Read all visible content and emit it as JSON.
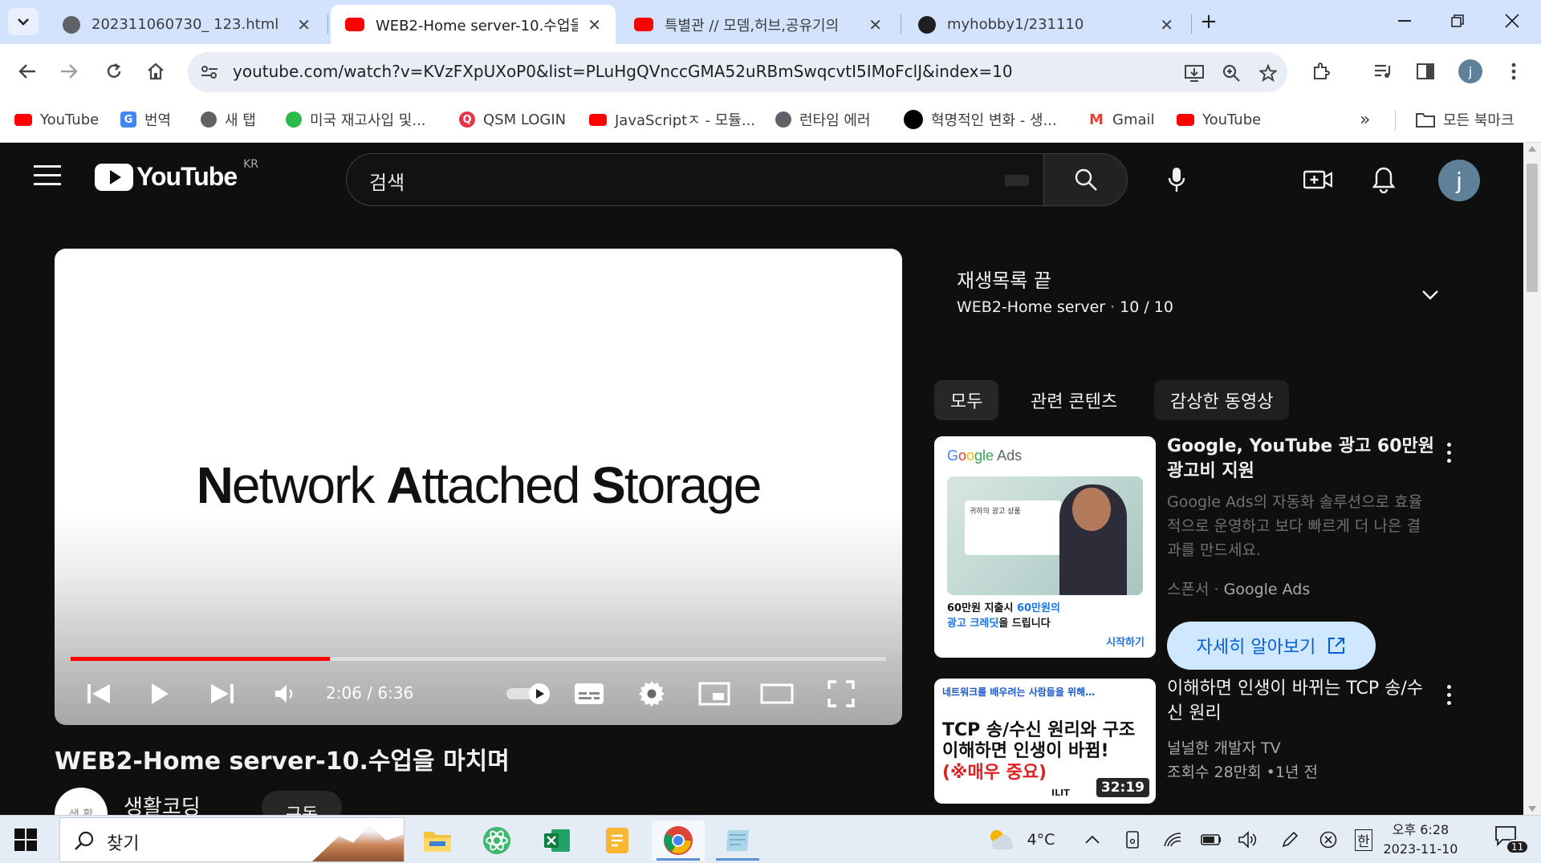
{
  "browser": {
    "tabs": [
      {
        "title": "202311060730_ 123.html",
        "icon": "globe-icon"
      },
      {
        "title": "WEB2-Home server-10.수업을",
        "icon": "youtube-icon",
        "active": true
      },
      {
        "title": "특별관 // 모뎀,허브,공유기의 ",
        "icon": "youtube-icon"
      },
      {
        "title": "myhobby1/231110",
        "icon": "github-icon"
      }
    ],
    "url": "youtube.com/watch?v=KVzFXpUXoP0&list=PLuHgQVnccGMA52uRBmSwqcvtI5IMoFclJ&index=10",
    "profile_initial": "j",
    "bookmarks": [
      {
        "label": "YouTube",
        "icon": "youtube-icon"
      },
      {
        "label": "번역",
        "icon": "translate-icon"
      },
      {
        "label": "새 탭",
        "icon": "globe-icon"
      },
      {
        "label": "미국 재고사입 및...",
        "icon": "frog-icon"
      },
      {
        "label": "QSM LOGIN",
        "icon": "q-icon"
      },
      {
        "label": "JavaScriptㅈ - 모듈...",
        "icon": "youtube-icon"
      },
      {
        "label": "런타임 에러",
        "icon": "globe-icon"
      },
      {
        "label": "혁명적인 변화 - 생...",
        "icon": "black-circle-icon"
      },
      {
        "label": "Gmail",
        "icon": "gmail-icon"
      },
      {
        "label": "YouTube",
        "icon": "youtube-icon"
      }
    ],
    "bookmarks_more": "»",
    "all_bookmarks": "모든 북마크"
  },
  "youtube": {
    "logo_text": "YouTube",
    "region": "KR",
    "search_placeholder": "검색",
    "avatar_initial": "j",
    "player": {
      "slide_text": {
        "n": "N",
        "etwork": "etwork ",
        "a": "A",
        "ttached": "ttached ",
        "s": "S",
        "torage": "torage"
      },
      "time": "2:06 / 6:36",
      "progress_fraction": 0.318
    },
    "video_title": "WEB2-Home server-10.수업을 마치며",
    "channel_avatar_text": "생 활",
    "channel_name": "생활코딩",
    "subscribe_label": "구독",
    "playlist": {
      "title": "재생목록 끝",
      "name": "WEB2-Home server",
      "separator": "·",
      "position": "10 / 10"
    },
    "chips": [
      "모두",
      "관련 콘텐츠",
      "감상한 동영상"
    ],
    "ad": {
      "brand": {
        "g1": "G",
        "g2": "o",
        "g3": "o",
        "g4": "gle",
        "ads": " Ads"
      },
      "card_text": "귀하의 광고 상품",
      "caption_line1_a": "60만원 지출시 ",
      "caption_line1_b": "60만원의",
      "caption_line2_a": "광고 크레딧",
      "caption_line2_b": "을 드립니다",
      "cta_small": "시작하기",
      "title": "Google, YouTube 광고 60만원 광고비 지원",
      "description": "Google Ads의 자동화 솔루션으로 효율적으로 운영하고 보다 빠르게 더 나은 결과를 만드세요.",
      "sponsor_label": "스폰서",
      "sponsor_dot": "·",
      "sponsor_name": "Google Ads",
      "learn_more": "자세히 알아보기"
    },
    "rec": {
      "thumb_top": "네트워크를 배우려는 사람들을 위해…",
      "thumb_line1": "TCP 송/수신 원리와 구조",
      "thumb_line2": "이해하면 인생이 바뀜!",
      "thumb_line3": "(※매우 중요)",
      "thumb_logo": "ILIT",
      "duration": "32:19",
      "title": "이해하면 인생이 바뀌는 TCP 송/수신 원리",
      "channel": "널널한 개발자 TV",
      "views": "조회수 28만회",
      "age": "•1년 전"
    }
  },
  "taskbar": {
    "search_label": "찾기",
    "weather": "4°C",
    "ime": "한",
    "time": "오후 6:28",
    "date": "2023-11-10",
    "notification_count": "11"
  },
  "colors": {
    "yt_bg": "#0f0f0f",
    "accent_red": "#ff0000",
    "chrome_tabstrip": "#d3e3fd"
  }
}
